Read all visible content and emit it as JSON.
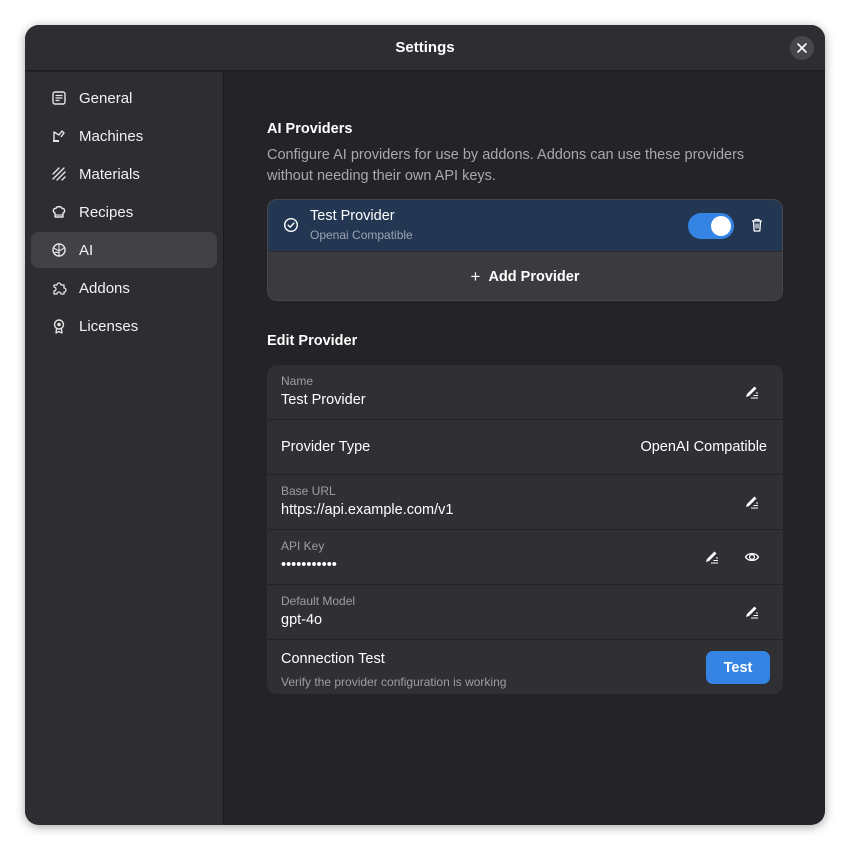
{
  "window": {
    "title": "Settings"
  },
  "sidebar": {
    "items": [
      {
        "label": "General",
        "icon": "general-icon",
        "active": false
      },
      {
        "label": "Machines",
        "icon": "machine-icon",
        "active": false
      },
      {
        "label": "Materials",
        "icon": "materials-icon",
        "active": false
      },
      {
        "label": "Recipes",
        "icon": "recipes-icon",
        "active": false
      },
      {
        "label": "AI",
        "icon": "ai-icon",
        "active": true
      },
      {
        "label": "Addons",
        "icon": "puzzle-icon",
        "active": false
      },
      {
        "label": "Licenses",
        "icon": "license-icon",
        "active": false
      }
    ]
  },
  "providers": {
    "title": "AI Providers",
    "description": "Configure AI providers for use by addons. Addons can use these providers without needing their own API keys.",
    "list": [
      {
        "name": "Test Provider",
        "type": "Openai Compatible",
        "enabled": true
      }
    ],
    "add_label": "Add Provider"
  },
  "edit": {
    "title": "Edit Provider",
    "name_label": "Name",
    "name_value": "Test Provider",
    "type_label": "Provider Type",
    "type_value": "OpenAI Compatible",
    "base_url_label": "Base URL",
    "base_url_value": "https://api.example.com/v1",
    "api_key_label": "API Key",
    "api_key_value": "•••••••••••",
    "model_label": "Default Model",
    "model_value": "gpt-4o",
    "test_title": "Connection Test",
    "test_subtitle": "Verify the provider configuration is working",
    "test_button": "Test"
  },
  "colors": {
    "accent": "#3584e4",
    "selected_row": "#233753",
    "window_bg": "#242428",
    "sidebar_bg": "#2e2e32"
  }
}
